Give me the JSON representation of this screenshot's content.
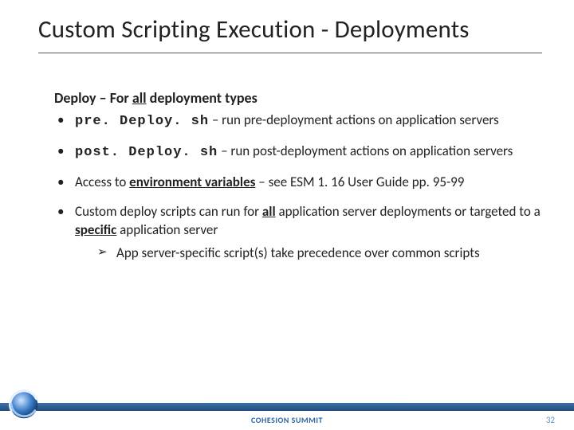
{
  "title": "Custom Scripting Execution - Deployments",
  "subhead_prefix": "Deploy – For ",
  "subhead_bold": "all",
  "subhead_suffix": " deployment types",
  "bullets": [
    {
      "code": "pre. Deploy. sh",
      "rest": " – run pre-deployment actions on application servers"
    },
    {
      "code": "post. Deploy. sh",
      "rest": " – run post-deployment actions on application servers"
    }
  ],
  "b3_a": "Access to ",
  "b3_env": "environment variables",
  "b3_b": " – see ESM 1. 16 User Guide pp. 95-99",
  "b4_a": "Custom deploy scripts can run for ",
  "b4_all": "all",
  "b4_b": " application server deployments or targeted to a ",
  "b4_spec": "specific",
  "b4_c": " application server",
  "b4_sub": "App server-specific script(s) take precedence over common scripts",
  "footer": "COHESION SUMMIT",
  "page": "32"
}
